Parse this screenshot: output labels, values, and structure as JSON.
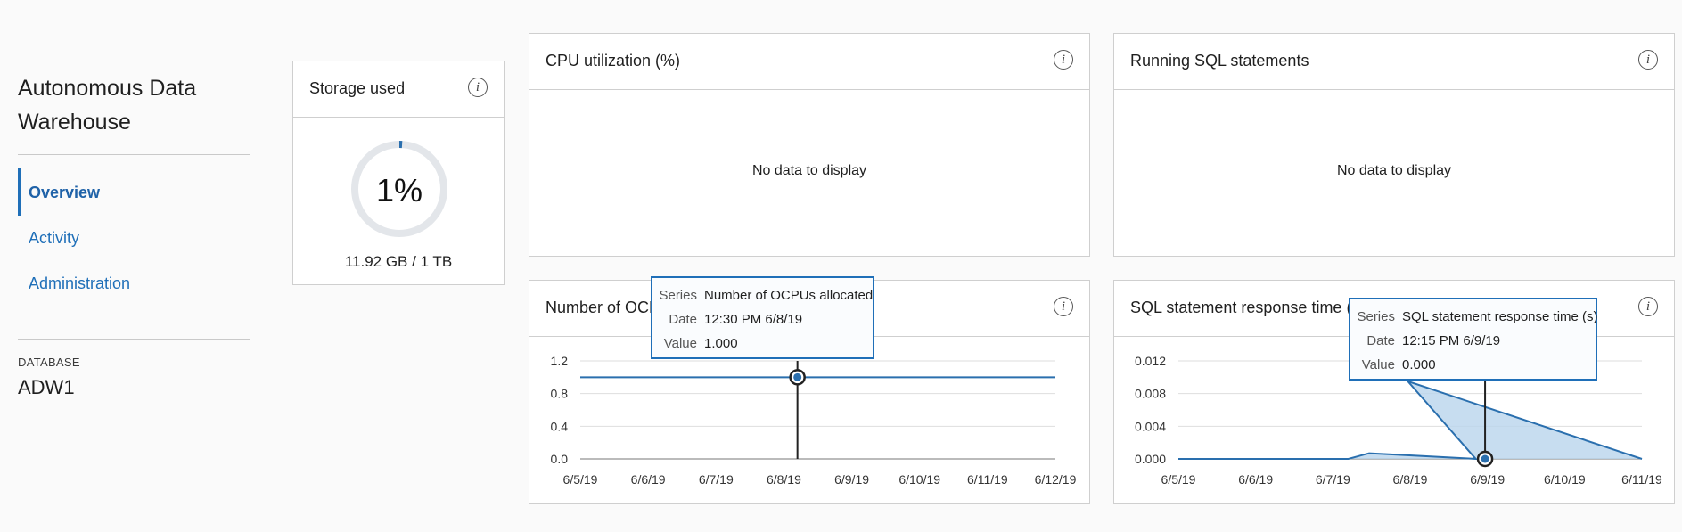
{
  "app": {
    "title": "Autonomous Data Warehouse"
  },
  "nav": {
    "items": [
      {
        "label": "Overview",
        "active": true
      },
      {
        "label": "Activity",
        "active": false
      },
      {
        "label": "Administration",
        "active": false
      }
    ]
  },
  "database": {
    "label": "DATABASE",
    "name": "ADW1"
  },
  "storage": {
    "title": "Storage used",
    "percent_label": "1%",
    "percent": 0.01,
    "usage_text": "11.92 GB / 1 TB"
  },
  "cpu": {
    "title": "CPU utilization (%)",
    "empty_text": "No data to display"
  },
  "running_sql": {
    "title": "Running SQL statements",
    "empty_text": "No data to display"
  },
  "ocpus": {
    "title": "Number of OCPUs allocated",
    "tooltip": {
      "series_key": "Series",
      "series": "Number of OCPUs allocated",
      "date_key": "Date",
      "date": "12:30 PM 6/8/19",
      "value_key": "Value",
      "value": "1.000"
    }
  },
  "sql_response": {
    "title": "SQL statement response time (s)",
    "tooltip": {
      "series_key": "Series",
      "series": "SQL statement response time (s)",
      "date_key": "Date",
      "date": "12:15 PM 6/9/19",
      "value_key": "Value",
      "value": "0.000"
    }
  },
  "colors": {
    "accent": "#1f6fb8",
    "line": "#2a6fae",
    "donut_track": "#e3e6ea"
  },
  "chart_data": [
    {
      "type": "line",
      "series": [
        {
          "name": "Number of OCPUs allocated",
          "x": [
            "6/5/19",
            "6/12/19"
          ],
          "values": [
            1,
            1
          ]
        }
      ],
      "x_ticks": [
        "6/5/19",
        "6/6/19",
        "6/7/19",
        "6/8/19",
        "6/9/19",
        "6/10/19",
        "6/11/19",
        "6/12/19"
      ],
      "y_ticks": [
        "1.2",
        "0.8",
        "0.4",
        "0.0"
      ],
      "ylim": [
        0,
        1.2
      ],
      "highlight": {
        "x": "6/8/19",
        "value": 1.0
      }
    },
    {
      "type": "area",
      "series": [
        {
          "name": "SQL statement response time (s)",
          "x": [
            "6/5/19",
            "6/7/19",
            "6/7/19",
            "6/8/19",
            "6/8/19",
            "6/11/19"
          ],
          "values": [
            0,
            0,
            0.0007,
            0,
            0.0095,
            0
          ]
        }
      ],
      "x_ticks": [
        "6/5/19",
        "6/6/19",
        "6/7/19",
        "6/8/19",
        "6/9/19",
        "6/10/19",
        "6/11/19"
      ],
      "y_ticks": [
        "0.012",
        "0.008",
        "0.004",
        "0.000"
      ],
      "ylim": [
        0,
        0.012
      ],
      "highlight": {
        "x": "6/9/19",
        "value": 0.0
      }
    }
  ]
}
